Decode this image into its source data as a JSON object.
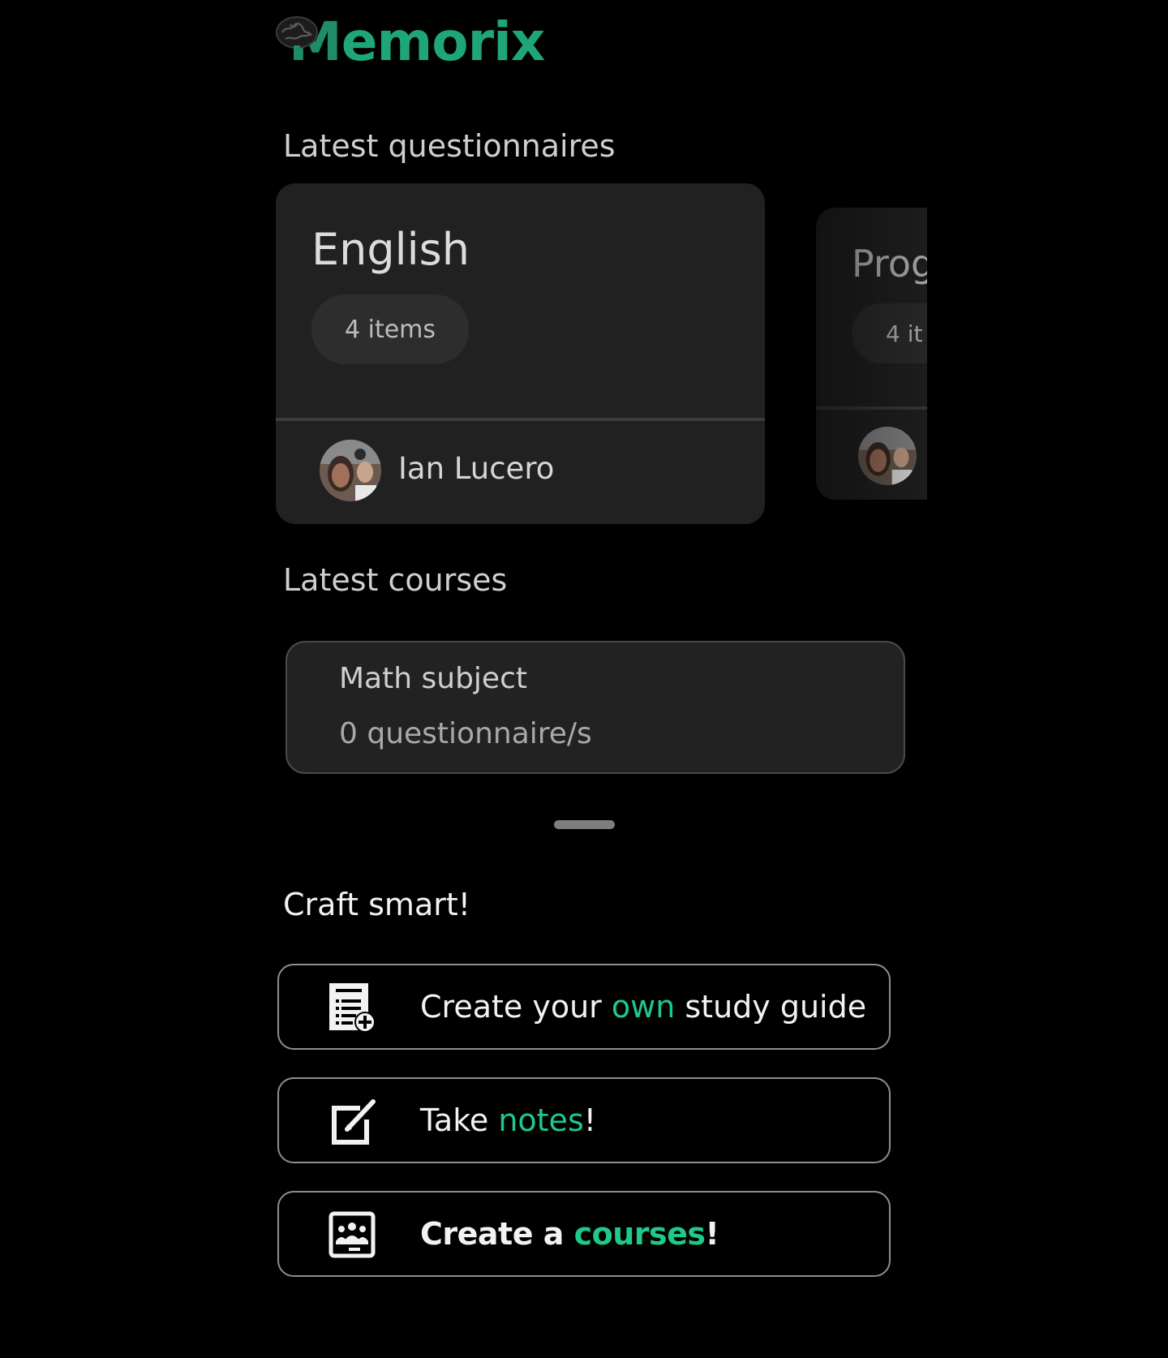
{
  "app": {
    "logo_text_first": "M",
    "logo_text_rest": "emorix",
    "brand_color": "#1ea67a"
  },
  "questionnaires": {
    "section_title": "Latest questionnaires",
    "cards": [
      {
        "name": "English",
        "items_label": "4 items",
        "owner": "Ian Lucero"
      },
      {
        "name": "Prog",
        "items_label": "4 it"
      }
    ]
  },
  "courses": {
    "section_title": "Latest courses",
    "items": [
      {
        "title": "Math subject",
        "count_label": "0 questionnaire/s"
      }
    ]
  },
  "craft": {
    "section_title": "Craft smart!",
    "actions": [
      {
        "icon": "document-add-icon",
        "text_before": "Create your ",
        "highlight": "own",
        "text_after": " study guide"
      },
      {
        "icon": "edit-note-icon",
        "text_before": "Take ",
        "highlight": "notes",
        "text_after": "!"
      },
      {
        "icon": "classroom-icon",
        "text_before": "Create a ",
        "highlight": "courses",
        "text_after": "!"
      }
    ],
    "highlight_color": "#1ec98a"
  }
}
